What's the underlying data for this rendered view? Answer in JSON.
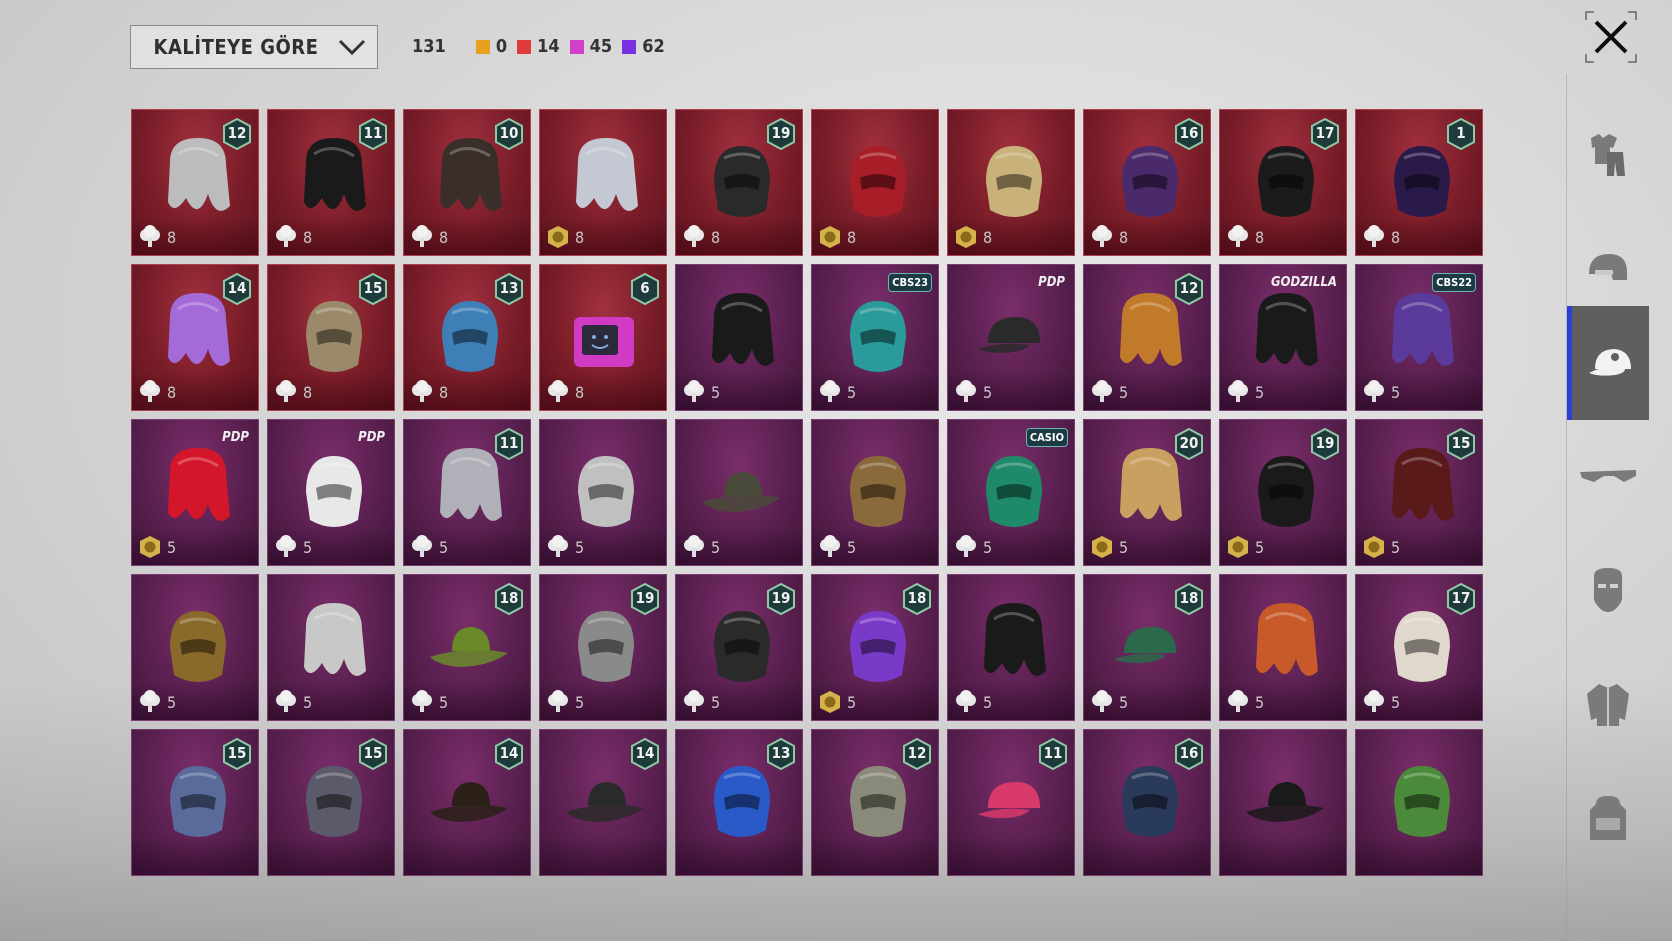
{
  "sort_dropdown": {
    "label": "KALİTEYE GÖRE"
  },
  "counts": {
    "total": "131",
    "items": [
      {
        "color": "#e6a21f",
        "value": "0"
      },
      {
        "color": "#e23a3a",
        "value": "14"
      },
      {
        "color": "#d23fc8",
        "value": "45"
      },
      {
        "color": "#7a2fe0",
        "value": "62"
      }
    ]
  },
  "sidebar": {
    "items": [
      {
        "icon": "outfit-icon",
        "active": false
      },
      {
        "icon": "helmet-icon",
        "active": false
      },
      {
        "icon": "cap-icon",
        "active": true
      },
      {
        "icon": "glasses-icon",
        "active": false
      },
      {
        "icon": "mask-icon",
        "active": false
      },
      {
        "icon": "jacket-icon",
        "active": false
      },
      {
        "icon": "backpack-icon",
        "active": false
      }
    ]
  },
  "grid": {
    "items": [
      {
        "rarity": "red",
        "coin": "silver",
        "cost": "8",
        "badge": "12",
        "tag": ""
      },
      {
        "rarity": "red",
        "coin": "silver",
        "cost": "8",
        "badge": "11",
        "tag": ""
      },
      {
        "rarity": "red",
        "coin": "silver",
        "cost": "8",
        "badge": "10",
        "tag": ""
      },
      {
        "rarity": "red",
        "coin": "gold",
        "cost": "8",
        "badge": "",
        "tag": ""
      },
      {
        "rarity": "red",
        "coin": "silver",
        "cost": "8",
        "badge": "19",
        "tag": ""
      },
      {
        "rarity": "red",
        "coin": "gold",
        "cost": "8",
        "badge": "",
        "tag": ""
      },
      {
        "rarity": "red",
        "coin": "gold",
        "cost": "8",
        "badge": "",
        "tag": ""
      },
      {
        "rarity": "red",
        "coin": "silver",
        "cost": "8",
        "badge": "16",
        "tag": ""
      },
      {
        "rarity": "red",
        "coin": "silver",
        "cost": "8",
        "badge": "17",
        "tag": ""
      },
      {
        "rarity": "red",
        "coin": "silver",
        "cost": "8",
        "badge": "1",
        "tag": ""
      },
      {
        "rarity": "red",
        "coin": "silver",
        "cost": "8",
        "badge": "14",
        "tag": ""
      },
      {
        "rarity": "red",
        "coin": "silver",
        "cost": "8",
        "badge": "15",
        "tag": ""
      },
      {
        "rarity": "red",
        "coin": "silver",
        "cost": "8",
        "badge": "13",
        "tag": ""
      },
      {
        "rarity": "red",
        "coin": "silver",
        "cost": "8",
        "badge": "6",
        "tag": ""
      },
      {
        "rarity": "purple",
        "coin": "silver",
        "cost": "5",
        "badge": "",
        "tag": ""
      },
      {
        "rarity": "purple",
        "coin": "silver",
        "cost": "5",
        "badge": "",
        "tag": "CBS23"
      },
      {
        "rarity": "purple",
        "coin": "silver",
        "cost": "5",
        "badge": "",
        "tag": "PDP"
      },
      {
        "rarity": "purple",
        "coin": "silver",
        "cost": "5",
        "badge": "12",
        "tag": ""
      },
      {
        "rarity": "purple",
        "coin": "silver",
        "cost": "5",
        "badge": "",
        "tag": "GODZILLA"
      },
      {
        "rarity": "purple",
        "coin": "silver",
        "cost": "5",
        "badge": "",
        "tag": "CBS22"
      },
      {
        "rarity": "purple",
        "coin": "gold",
        "cost": "5",
        "badge": "",
        "tag": "PDP"
      },
      {
        "rarity": "purple",
        "coin": "silver",
        "cost": "5",
        "badge": "",
        "tag": "PDP"
      },
      {
        "rarity": "purple",
        "coin": "silver",
        "cost": "5",
        "badge": "11",
        "tag": ""
      },
      {
        "rarity": "purple",
        "coin": "silver",
        "cost": "5",
        "badge": "",
        "tag": ""
      },
      {
        "rarity": "purple",
        "coin": "silver",
        "cost": "5",
        "badge": "",
        "tag": ""
      },
      {
        "rarity": "purple",
        "coin": "silver",
        "cost": "5",
        "badge": "",
        "tag": ""
      },
      {
        "rarity": "purple",
        "coin": "silver",
        "cost": "5",
        "badge": "",
        "tag": "CASIO"
      },
      {
        "rarity": "purple",
        "coin": "gold",
        "cost": "5",
        "badge": "20",
        "tag": ""
      },
      {
        "rarity": "purple",
        "coin": "gold",
        "cost": "5",
        "badge": "19",
        "tag": ""
      },
      {
        "rarity": "purple",
        "coin": "gold",
        "cost": "5",
        "badge": "15",
        "tag": ""
      },
      {
        "rarity": "purple",
        "coin": "silver",
        "cost": "5",
        "badge": "",
        "tag": ""
      },
      {
        "rarity": "purple",
        "coin": "silver",
        "cost": "5",
        "badge": "",
        "tag": ""
      },
      {
        "rarity": "purple",
        "coin": "silver",
        "cost": "5",
        "badge": "18",
        "tag": ""
      },
      {
        "rarity": "purple",
        "coin": "silver",
        "cost": "5",
        "badge": "19",
        "tag": ""
      },
      {
        "rarity": "purple",
        "coin": "silver",
        "cost": "5",
        "badge": "19",
        "tag": ""
      },
      {
        "rarity": "purple",
        "coin": "gold",
        "cost": "5",
        "badge": "18",
        "tag": ""
      },
      {
        "rarity": "purple",
        "coin": "silver",
        "cost": "5",
        "badge": "",
        "tag": ""
      },
      {
        "rarity": "purple",
        "coin": "silver",
        "cost": "5",
        "badge": "18",
        "tag": ""
      },
      {
        "rarity": "purple",
        "coin": "silver",
        "cost": "5",
        "badge": "",
        "tag": ""
      },
      {
        "rarity": "purple",
        "coin": "silver",
        "cost": "5",
        "badge": "17",
        "tag": ""
      },
      {
        "rarity": "purple",
        "coin": "",
        "cost": "",
        "badge": "15",
        "tag": ""
      },
      {
        "rarity": "purple",
        "coin": "",
        "cost": "",
        "badge": "15",
        "tag": ""
      },
      {
        "rarity": "purple",
        "coin": "",
        "cost": "",
        "badge": "14",
        "tag": ""
      },
      {
        "rarity": "purple",
        "coin": "",
        "cost": "",
        "badge": "14",
        "tag": ""
      },
      {
        "rarity": "purple",
        "coin": "",
        "cost": "",
        "badge": "13",
        "tag": ""
      },
      {
        "rarity": "purple",
        "coin": "",
        "cost": "",
        "badge": "12",
        "tag": ""
      },
      {
        "rarity": "purple",
        "coin": "",
        "cost": "",
        "badge": "11",
        "tag": ""
      },
      {
        "rarity": "purple",
        "coin": "",
        "cost": "",
        "badge": "16",
        "tag": ""
      },
      {
        "rarity": "purple",
        "coin": "",
        "cost": "",
        "badge": "",
        "tag": ""
      },
      {
        "rarity": "purple",
        "coin": "",
        "cost": "",
        "badge": "",
        "tag": ""
      }
    ]
  }
}
